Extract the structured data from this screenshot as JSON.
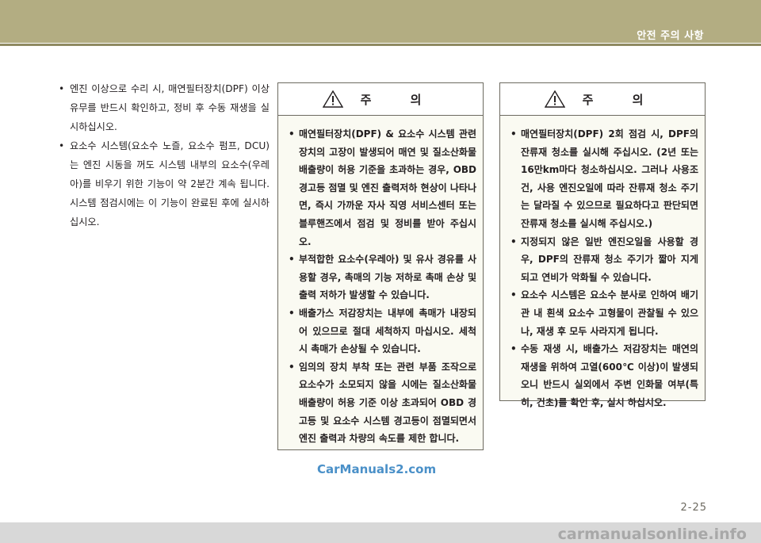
{
  "header": {
    "section_title": "안전 주의 사항"
  },
  "left_column": {
    "items": [
      "엔진 이상으로 수리 시, 매연필터장치(DPF) 이상 유무를 반드시 확인하고, 정비 후 수동 재생을 실시하십시오.",
      "요소수 시스템(요소수 노즐, 요소수 펌프, DCU)는 엔진 시동을 꺼도 시스템 내부의 요소수(우레아)를 비우기 위한 기능이 약 2분간 계속 됩니다. 시스템 점검시에는 이 기능이 완료된 후에 실시하십시오."
    ]
  },
  "caution_box_1": {
    "title": "주 의",
    "icon": "warning-triangle-icon",
    "items": [
      "매연필터장치(DPF) & 요소수 시스템 관련 장치의 고장이 발생되어 매연 및 질소산화물 배출량이 허용 기준을 초과하는 경우, OBD 경고등 점멸 및 엔진 출력저하 현상이 나타나면, 즉시 가까운 자사 직영 서비스센터 또는 블루핸즈에서 점검 및 정비를 받아 주십시오.",
      "부적합한 요소수(우레아) 및 유사 경유를 사용할 경우, 촉매의 기능 저하로 촉매 손상 및 출력 저하가 발생할 수 있습니다.",
      "배출가스 저감장치는 내부에 촉매가 내장되어 있으므로 절대 세척하지 마십시오. 세척 시 촉매가 손상될 수 있습니다.",
      "임의의 장치 부착 또는 관련 부품 조작으로 요소수가 소모되지 않을 시에는 질소산화물 배출량이 허용 기준 이상 초과되어 OBD 경고등 및 요소수 시스템 경고등이 점멸되면서 엔진 출력과 차량의 속도를 제한 합니다."
    ]
  },
  "caution_box_2": {
    "title": "주 의",
    "icon": "warning-triangle-icon",
    "items": [
      "매연필터장치(DPF) 2회 점검 시, DPF의 잔류재 청소를 실시해 주십시오. (2년 또는 16만km마다 청소하십시오. 그러나 사용조건, 사용 엔진오일에 따라 잔류재 청소 주기는 달라질 수 있으므로 필요하다고 판단되면 잔류재 청소를 실시해 주십시오.)",
      "지정되지 않은 일반 엔진오일을 사용할 경우, DPF의 잔류재 청소 주기가 짧아 지게 되고 연비가 악화될 수 있습니다.",
      "요소수 시스템은 요소수 분사로 인하여 배기관 내 흰색 요소수 고형물이 관찰될 수 있으나, 재생 후 모두 사라지게 됩니다.",
      "수동 재생 시, 배출가스 저감장치는 매연의 재생을 위하여 고열(600℃ 이상)이 발생되오니 반드시 실외에서 주변 인화물 여부(특히, 건초)를 확인 후, 실시 하십시오."
    ]
  },
  "watermark_mid": "CarManuals2.com",
  "page_number": "2-25",
  "watermark_footer": "carmanualsonline.info",
  "colors": {
    "header_band": "#b3ad82",
    "box_border": "#6d6a60",
    "watermark_blue": "#4a90c8"
  }
}
